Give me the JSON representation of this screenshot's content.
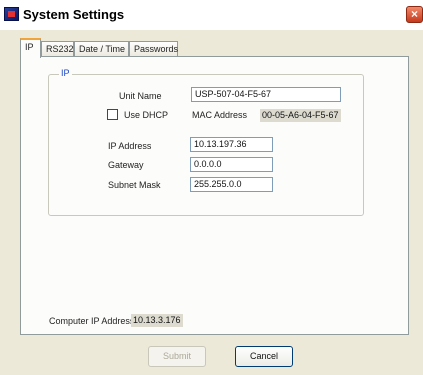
{
  "window": {
    "title": "System Settings",
    "close_glyph": "×"
  },
  "tabs": [
    {
      "label": "IP"
    },
    {
      "label": "RS232"
    },
    {
      "label": "Date / Time"
    },
    {
      "label": "Passwords"
    }
  ],
  "ip_group": {
    "legend": "IP",
    "unit_name_label": "Unit Name",
    "unit_name_value": "USP-507-04-F5-67",
    "use_dhcp_label": "Use DHCP",
    "use_dhcp_checked": false,
    "mac_label": "MAC Address",
    "mac_value": "00-05-A6-04-F5-67",
    "ip_label": "IP Address",
    "ip_value": "10.13.197.36",
    "gateway_label": "Gateway",
    "gateway_value": "0.0.0.0",
    "subnet_label": "Subnet Mask",
    "subnet_value": "255.255.0.0"
  },
  "computer_ip": {
    "label": "Computer IP Address",
    "value": "10.13.3.176"
  },
  "buttons": {
    "submit": "Submit",
    "cancel": "Cancel"
  },
  "icons": {
    "app": "app-window-icon",
    "close": "close-icon"
  },
  "colors": {
    "tab_highlight": "#f1a43a",
    "legend_text": "#1b47c6",
    "close_button": "#c7391c"
  }
}
